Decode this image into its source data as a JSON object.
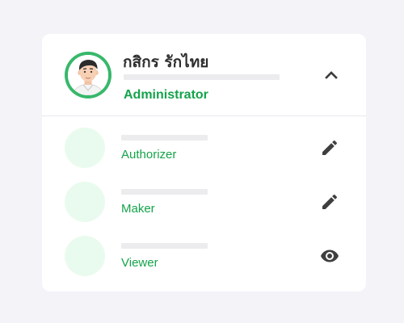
{
  "user": {
    "name": "กสิกร รักไทย",
    "role": "Administrator"
  },
  "roles": [
    {
      "label": "Authorizer",
      "action_icon": "pencil-icon"
    },
    {
      "label": "Maker",
      "action_icon": "pencil-icon"
    },
    {
      "label": "Viewer",
      "action_icon": "eye-icon"
    }
  ],
  "colors": {
    "accent": "#14a34a",
    "avatar_ring": "#37b86b",
    "role_circle": "#e9fbee",
    "background": "#f3f3f8"
  },
  "header": {
    "toggle_icon": "chevron-up-icon"
  }
}
